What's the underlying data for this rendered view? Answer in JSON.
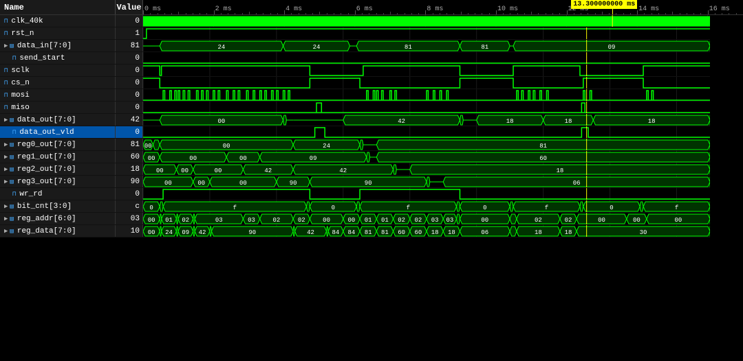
{
  "header": {
    "name_col": "Name",
    "value_col": "Value",
    "cursor_label": "13.300000000 ms",
    "timeline_markers": [
      "0 ms",
      "2 ms",
      "4 ms",
      "6 ms",
      "8 ms",
      "10 ms",
      "12 ms",
      "14 ms",
      "16 ms"
    ]
  },
  "signals": [
    {
      "id": "clk_40k",
      "name": "clk_40k",
      "value": "0",
      "type": "bit",
      "indent": 0,
      "selected": false
    },
    {
      "id": "rst_n",
      "name": "rst_n",
      "value": "1",
      "type": "bit",
      "indent": 0,
      "selected": false
    },
    {
      "id": "data_in",
      "name": "data_in[7:0]",
      "value": "81",
      "type": "bus",
      "indent": 0,
      "selected": false,
      "expandable": true
    },
    {
      "id": "send_start",
      "name": "send_start",
      "value": "0",
      "type": "bit",
      "indent": 1,
      "selected": false
    },
    {
      "id": "sclk",
      "name": "sclk",
      "value": "0",
      "type": "bit",
      "indent": 0,
      "selected": false
    },
    {
      "id": "cs_n",
      "name": "cs_n",
      "value": "0",
      "type": "bit",
      "indent": 0,
      "selected": false
    },
    {
      "id": "mosi",
      "name": "mosi",
      "value": "0",
      "type": "bit",
      "indent": 0,
      "selected": false
    },
    {
      "id": "miso",
      "name": "miso",
      "value": "0",
      "type": "bit",
      "indent": 0,
      "selected": false
    },
    {
      "id": "data_out",
      "name": "data_out[7:0]",
      "value": "42",
      "type": "bus",
      "indent": 0,
      "selected": false,
      "expandable": true
    },
    {
      "id": "data_out_vld",
      "name": "data_out_vld",
      "value": "0",
      "type": "bit",
      "indent": 1,
      "selected": true
    },
    {
      "id": "reg0_out",
      "name": "reg0_out[7:0]",
      "value": "81",
      "type": "bus",
      "indent": 0,
      "selected": false,
      "expandable": true
    },
    {
      "id": "reg1_out",
      "name": "reg1_out[7:0]",
      "value": "60",
      "type": "bus",
      "indent": 0,
      "selected": false,
      "expandable": true
    },
    {
      "id": "reg2_out",
      "name": "reg2_out[7:0]",
      "value": "18",
      "type": "bus",
      "indent": 0,
      "selected": false,
      "expandable": true
    },
    {
      "id": "reg3_out",
      "name": "reg3_out[7:0]",
      "value": "90",
      "type": "bus",
      "indent": 0,
      "selected": false,
      "expandable": true
    },
    {
      "id": "wr_rd",
      "name": "wr_rd",
      "value": "0",
      "type": "bit",
      "indent": 1,
      "selected": false
    },
    {
      "id": "bit_cnt",
      "name": "bit_cnt[3:0]",
      "value": "c",
      "type": "bus",
      "indent": 0,
      "selected": false,
      "expandable": true
    },
    {
      "id": "reg_addr",
      "name": "reg_addr[6:0]",
      "value": "03",
      "type": "bus",
      "indent": 0,
      "selected": false,
      "expandable": true
    },
    {
      "id": "reg_data",
      "name": "reg_data[7:0]",
      "value": "10",
      "type": "bus",
      "indent": 0,
      "selected": false,
      "expandable": true
    }
  ]
}
